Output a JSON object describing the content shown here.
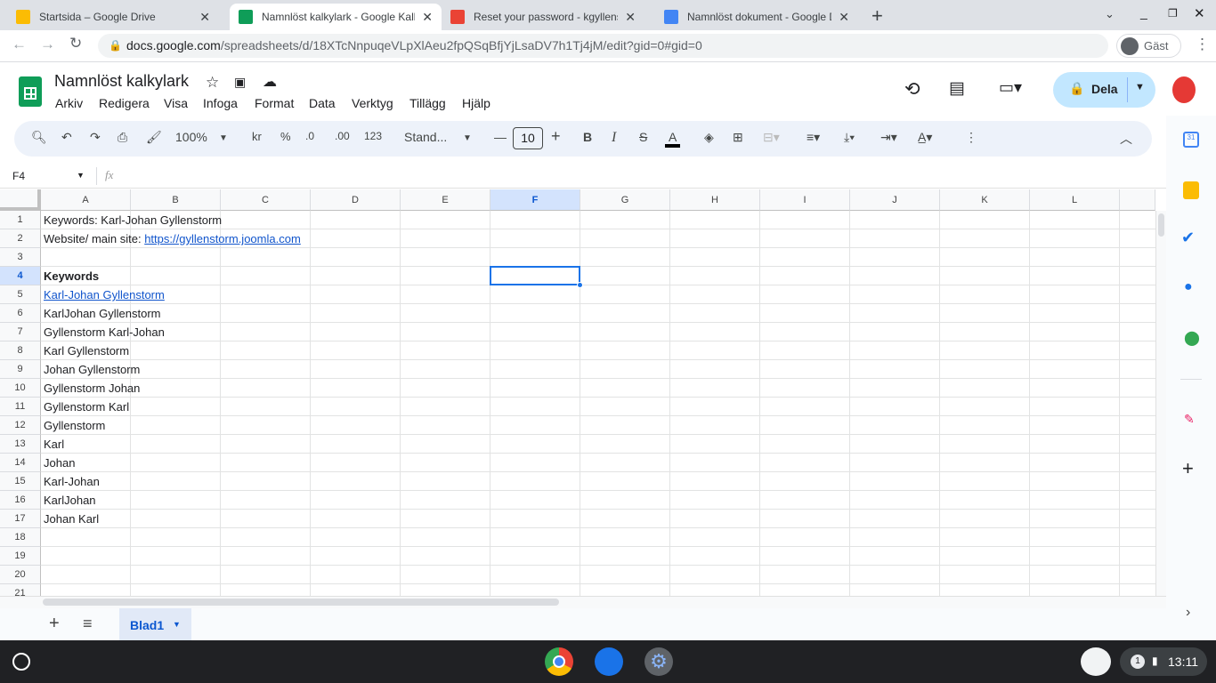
{
  "browser": {
    "tabs": [
      {
        "title": "Startsida – Google Drive",
        "color": "#fbbc04"
      },
      {
        "title": "Namnlöst kalkylark - Google Kalkylark",
        "color": "#0f9d58"
      },
      {
        "title": "Reset your password - kgyllenstorm",
        "color": "#ea4335"
      },
      {
        "title": "Namnlöst dokument - Google Dokument",
        "color": "#4285f4"
      }
    ],
    "url_domain": "docs.google.com",
    "url_path": "/spreadsheets/d/18XTcNnpuqeVLpXlAeu2fpQSqBfjYjLsaDV7h1Tj4jM/edit?gid=0#gid=0",
    "profile": "Gäst"
  },
  "doc": {
    "title": "Namnlöst kalkylark",
    "share": "Dela",
    "menus": [
      "Arkiv",
      "Redigera",
      "Visa",
      "Infoga",
      "Format",
      "Data",
      "Verktyg",
      "Tillägg",
      "Hjälp"
    ]
  },
  "toolbar": {
    "zoom": "100%",
    "currency": "kr",
    "percent": "%",
    "dec_less": ".0",
    "dec_more": ".00",
    "number_format": "123",
    "font": "Stand...",
    "font_size": "10"
  },
  "formula_bar": {
    "cell_ref": "F4",
    "fx": "fx",
    "value": ""
  },
  "columns": [
    "A",
    "B",
    "C",
    "D",
    "E",
    "F",
    "G",
    "H",
    "I",
    "J",
    "K",
    "L"
  ],
  "selected": {
    "column": "F",
    "row": 4
  },
  "rows": [
    {
      "n": "1",
      "a": "Keywords: Karl-Johan Gyllenstorm"
    },
    {
      "n": "2",
      "a": "Website/ main site: ",
      "link": "https://gyllenstorm.joomla.com"
    },
    {
      "n": "3",
      "a": ""
    },
    {
      "n": "4",
      "a": "Keywords",
      "bold": true
    },
    {
      "n": "5",
      "a": "Karl-Johan Gyllenstorm",
      "is_link": true
    },
    {
      "n": "6",
      "a": "KarlJohan Gyllenstorm"
    },
    {
      "n": "7",
      "a": "Gyllenstorm Karl-Johan"
    },
    {
      "n": "8",
      "a": "Karl Gyllenstorm"
    },
    {
      "n": "9",
      "a": "Johan Gyllenstorm"
    },
    {
      "n": "10",
      "a": "Gyllenstorm Johan"
    },
    {
      "n": "11",
      "a": "Gyllenstorm Karl"
    },
    {
      "n": "12",
      "a": "Gyllenstorm"
    },
    {
      "n": "13",
      "a": "Karl"
    },
    {
      "n": "14",
      "a": "Johan"
    },
    {
      "n": "15",
      "a": "Karl-Johan"
    },
    {
      "n": "16",
      "a": "KarlJohan"
    },
    {
      "n": "17",
      "a": "Johan Karl"
    },
    {
      "n": "18",
      "a": ""
    },
    {
      "n": "19",
      "a": ""
    },
    {
      "n": "20",
      "a": ""
    },
    {
      "n": "21",
      "a": ""
    }
  ],
  "sheets": [
    {
      "name": "Blad1",
      "active": true
    }
  ],
  "taskbar": {
    "notifications": "1",
    "time": "13:11"
  }
}
